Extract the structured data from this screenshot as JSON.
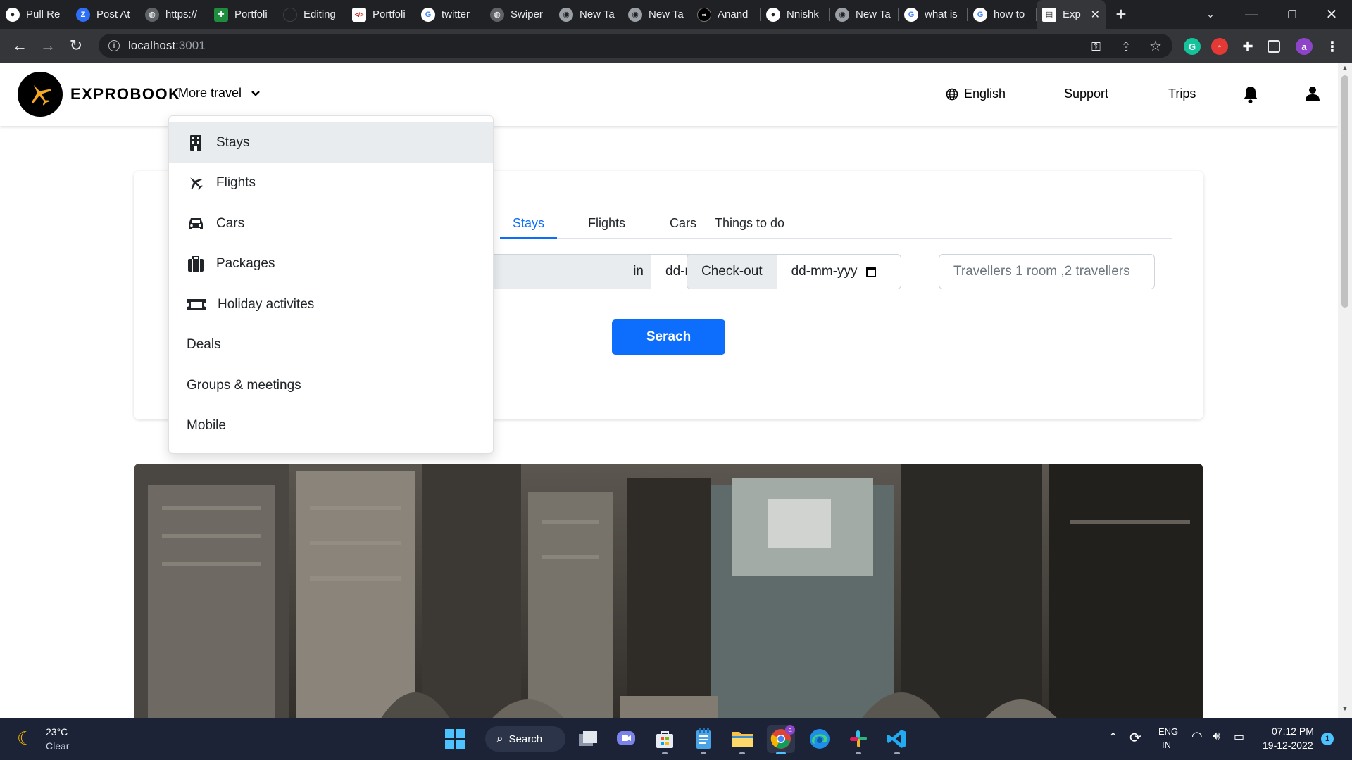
{
  "browser": {
    "tabs": [
      {
        "label": "Pull Re",
        "icon": "github-icon",
        "color": "#ffffff"
      },
      {
        "label": "Post At",
        "icon": "z-icon",
        "color": "#2d6ff7"
      },
      {
        "label": "https://",
        "icon": "globe-icon",
        "color": "#9aa0a6"
      },
      {
        "label": "Portfoli",
        "icon": "sheets-plus-icon",
        "color": "#1e8e3e"
      },
      {
        "label": "Editing",
        "icon": "blank-icon",
        "color": "#202124"
      },
      {
        "label": "Portfoli",
        "icon": "code-icon",
        "color": "#ffffff"
      },
      {
        "label": "twitter",
        "icon": "google-icon",
        "color": "#ffffff"
      },
      {
        "label": "Swiper",
        "icon": "globe-icon",
        "color": "#9aa0a6"
      },
      {
        "label": "New Ta",
        "icon": "chrome-icon",
        "color": "#9aa0a6"
      },
      {
        "label": "New Ta",
        "icon": "chrome-icon",
        "color": "#9aa0a6"
      },
      {
        "label": "Anand",
        "icon": "codepen-icon",
        "color": "#000000"
      },
      {
        "label": "Nnishk",
        "icon": "github-icon",
        "color": "#ffffff"
      },
      {
        "label": "New Ta",
        "icon": "chrome-icon",
        "color": "#9aa0a6"
      },
      {
        "label": "what is",
        "icon": "google-icon",
        "color": "#ffffff"
      },
      {
        "label": "how to",
        "icon": "google-icon",
        "color": "#ffffff"
      },
      {
        "label": "Exp",
        "icon": "page-icon",
        "color": "#ffffff",
        "active": true
      }
    ],
    "url_host": "localhost",
    "url_port": ":3001",
    "profile_initial": "a"
  },
  "site": {
    "brand": "EXPROBOOK",
    "more_travel": "More travel",
    "language": "English",
    "support": "Support",
    "trips": "Trips"
  },
  "dropdown": {
    "items": [
      {
        "label": "Stays",
        "icon": "building-icon"
      },
      {
        "label": "Flights",
        "icon": "plane-icon"
      },
      {
        "label": "Cars",
        "icon": "car-icon"
      },
      {
        "label": "Packages",
        "icon": "suitcase-icon"
      },
      {
        "label": "Holiday activites",
        "icon": "ticket-icon"
      },
      {
        "label": "Deals"
      },
      {
        "label": "Groups & meetings"
      },
      {
        "label": "Mobile"
      }
    ]
  },
  "search": {
    "tabs": [
      "Stays",
      "Flights",
      "Cars",
      "Things to do"
    ],
    "active_tab": "Stays",
    "checkin_label_partial": "in",
    "checkin_value": "dd-mm-yyyy",
    "checkout_label": "Check-out",
    "checkout_value": "dd-mm-yyy",
    "travellers_placeholder": "Travellers 1 room ,2 travellers",
    "search_button": "Serach"
  },
  "taskbar": {
    "weather_temp": "23°C",
    "weather_desc": "Clear",
    "search_label": "Search",
    "lang_top": "ENG",
    "lang_bottom": "IN",
    "time": "07:12 PM",
    "date": "19-12-2022",
    "notification_count": "1"
  },
  "colors": {
    "primary": "#0d6efd",
    "chrome_dark": "#202124",
    "taskbar": "#1c2336"
  }
}
